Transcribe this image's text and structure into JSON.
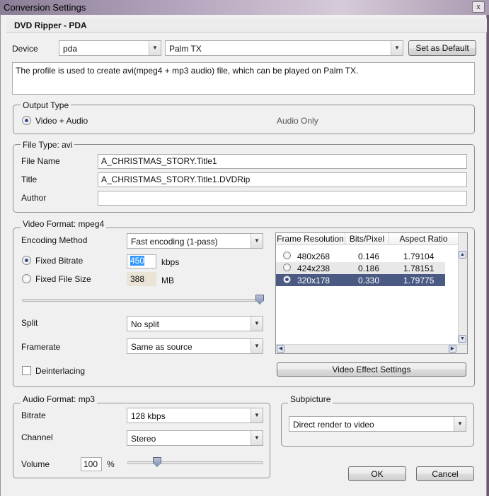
{
  "window": {
    "title": "Conversion Settings",
    "close": "x"
  },
  "header": {
    "title": "DVD Ripper - PDA"
  },
  "device": {
    "label": "Device",
    "category": "pda",
    "model": "Palm TX",
    "set_default": "Set as Default",
    "description": "The profile is used to create avi(mpeg4 + mp3 audio) file, which can be played on Palm TX."
  },
  "output_type": {
    "title": "Output Type",
    "video_audio": "Video + Audio",
    "audio_only": "Audio Only"
  },
  "file_type": {
    "title": "File Type: avi",
    "file_name_label": "File Name",
    "file_name": "A_CHRISTMAS_STORY.Title1",
    "title_label": "Title",
    "title_value": "A_CHRISTMAS_STORY.Title1.DVDRip",
    "author_label": "Author",
    "author": ""
  },
  "video": {
    "title": "Video Format: mpeg4",
    "encoding_label": "Encoding Method",
    "encoding": "Fast encoding (1-pass)",
    "fixed_bitrate_label": "Fixed Bitrate",
    "bitrate": "450",
    "bitrate_unit": "kbps",
    "fixed_size_label": "Fixed File Size",
    "size": "388",
    "size_unit": "MB",
    "quality_level": 1.0,
    "split_label": "Split",
    "split": "No split",
    "framerate_label": "Framerate",
    "framerate": "Same as source",
    "deinterlace_label": "Deinterlacing",
    "effects_button": "Video Effect Settings",
    "columns": [
      "Frame Resolution",
      "Bits/Pixel",
      "Aspect Ratio"
    ],
    "rows": [
      {
        "res": "480x268",
        "bpp": "0.146",
        "ar": "1.79104",
        "selected": false
      },
      {
        "res": "424x238",
        "bpp": "0.186",
        "ar": "1.78151",
        "selected": false
      },
      {
        "res": "320x178",
        "bpp": "0.330",
        "ar": "1.79775",
        "selected": true
      }
    ]
  },
  "audio": {
    "title": "Audio Format: mp3",
    "bitrate_label": "Bitrate",
    "bitrate": "128 kbps",
    "channel_label": "Channel",
    "channel": "Stereo",
    "volume_label": "Volume",
    "volume": "100",
    "volume_unit": "%",
    "volume_level": 0.2
  },
  "subpicture": {
    "title": "Subpicture",
    "value": "Direct render to video"
  },
  "footer": {
    "ok": "OK",
    "cancel": "Cancel"
  },
  "colors": {
    "selection": "#4a5a82",
    "radio_dot": "#3a4c8e"
  }
}
